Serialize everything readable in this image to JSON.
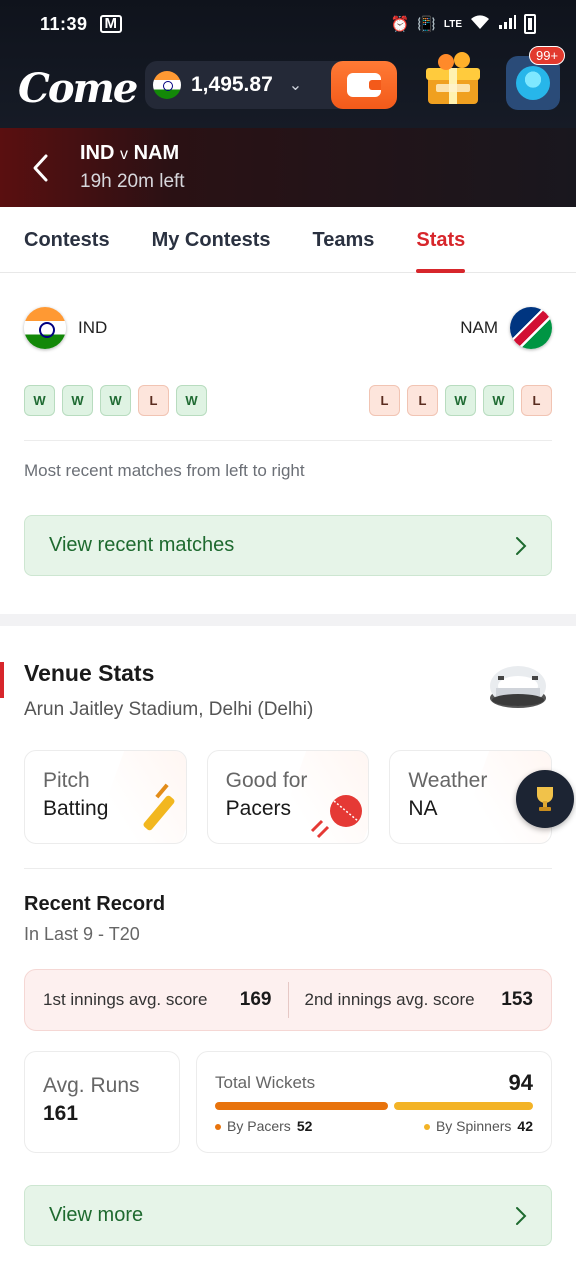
{
  "status_bar": {
    "time": "11:39",
    "mail_icon": "gmail-icon",
    "network_label": "LTE"
  },
  "header": {
    "logo": "Come",
    "balance": "1,495.87",
    "notification_badge": "99+"
  },
  "match": {
    "team1": "IND",
    "vs": "v",
    "team2": "NAM",
    "time_left": "19h 20m left"
  },
  "tabs": [
    {
      "label": "Contests",
      "active": false
    },
    {
      "label": "My Contests",
      "active": false
    },
    {
      "label": "Teams",
      "active": false
    },
    {
      "label": "Stats",
      "active": true
    }
  ],
  "form": {
    "team1": {
      "name": "IND",
      "results": [
        "W",
        "W",
        "W",
        "L",
        "W"
      ]
    },
    "team2": {
      "name": "NAM",
      "results": [
        "L",
        "L",
        "W",
        "W",
        "L"
      ]
    },
    "note": "Most recent matches from left to right",
    "cta": "View recent matches"
  },
  "venue": {
    "title": "Venue Stats",
    "stadium": "Arun Jaitley Stadium, Delhi (Delhi)",
    "cards": [
      {
        "label": "Pitch",
        "value": "Batting"
      },
      {
        "label": "Good for",
        "value": "Pacers"
      },
      {
        "label": "Weather",
        "value": "NA"
      }
    ]
  },
  "record": {
    "title": "Recent Record",
    "subtitle": "In Last 9 - T20",
    "first_innings_label": "1st innings avg. score",
    "first_innings_value": "169",
    "second_innings_label": "2nd innings avg. score",
    "second_innings_value": "153",
    "avg_runs_label": "Avg. Runs",
    "avg_runs_value": "161",
    "wickets_label": "Total Wickets",
    "wickets_total": "94",
    "pacers_label": "By Pacers",
    "pacers_value": "52",
    "spinners_label": "By Spinners",
    "spinners_value": "42",
    "cta": "View more"
  },
  "colors": {
    "accent": "#d7262b",
    "win_bg": "#dff3e3",
    "loss_bg": "#fde5dc",
    "pacer_bar": "#e8730c",
    "spinner_bar": "#f3b326"
  }
}
